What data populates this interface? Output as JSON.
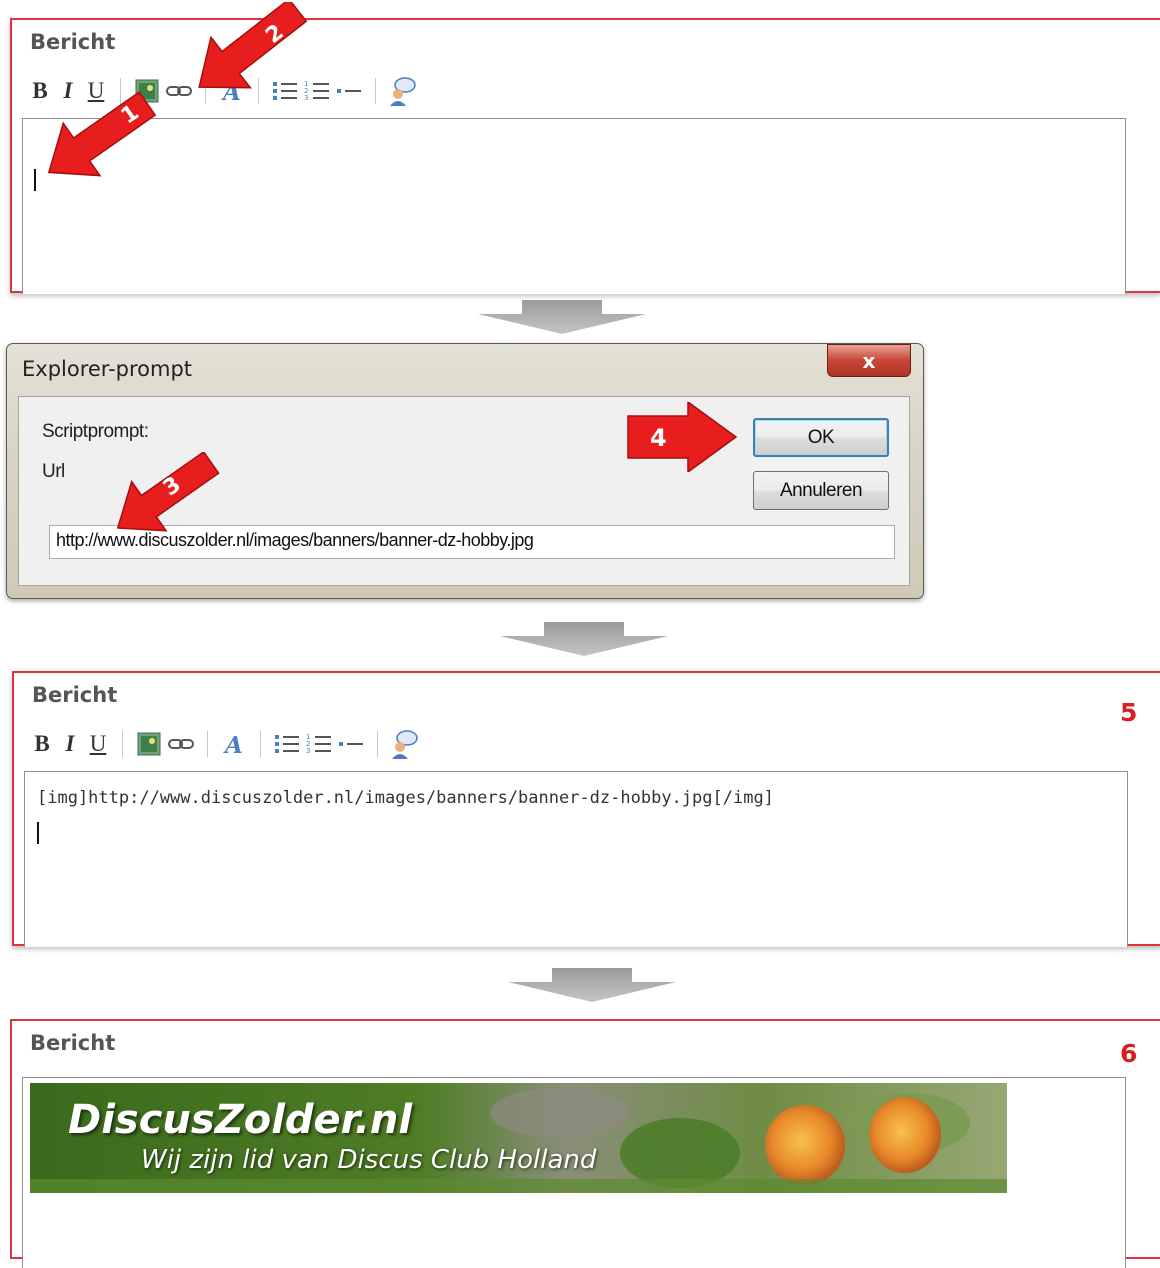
{
  "panel1": {
    "title": "Bericht",
    "toolbar": {
      "bold": "B",
      "italic": "I",
      "underline": "U"
    }
  },
  "dialog": {
    "title": "Explorer-prompt",
    "close": "x",
    "prompt_label": "Scriptprompt:",
    "field_label": "Url",
    "url_value": "http://www.discuszolder.nl/images/banners/banner-dz-hobby.jpg",
    "ok_label": "OK",
    "cancel_label": "Annuleren"
  },
  "panel2": {
    "title": "Bericht",
    "toolbar": {
      "bold": "B",
      "italic": "I",
      "underline": "U"
    },
    "content": "[img]http://www.discuszolder.nl/images/banners/banner-dz-hobby.jpg[/img]",
    "step": "5"
  },
  "panel3": {
    "title": "Bericht",
    "step": "6",
    "banner": {
      "title": "DiscusZolder.nl",
      "subtitle": "Wij zijn lid van Discus Club Holland"
    }
  },
  "annotations": [
    "1",
    "2",
    "3",
    "4"
  ],
  "colors": {
    "frame": "#d9363e",
    "step_red": "#d42020",
    "arrow_red": "#e81d1d",
    "flow_gray": "#a9a9a9"
  },
  "icons": [
    "image-icon",
    "link-icon",
    "font-color-icon",
    "bullet-list-icon",
    "numbered-list-icon",
    "horizontal-rule-icon",
    "quote-user-icon"
  ]
}
